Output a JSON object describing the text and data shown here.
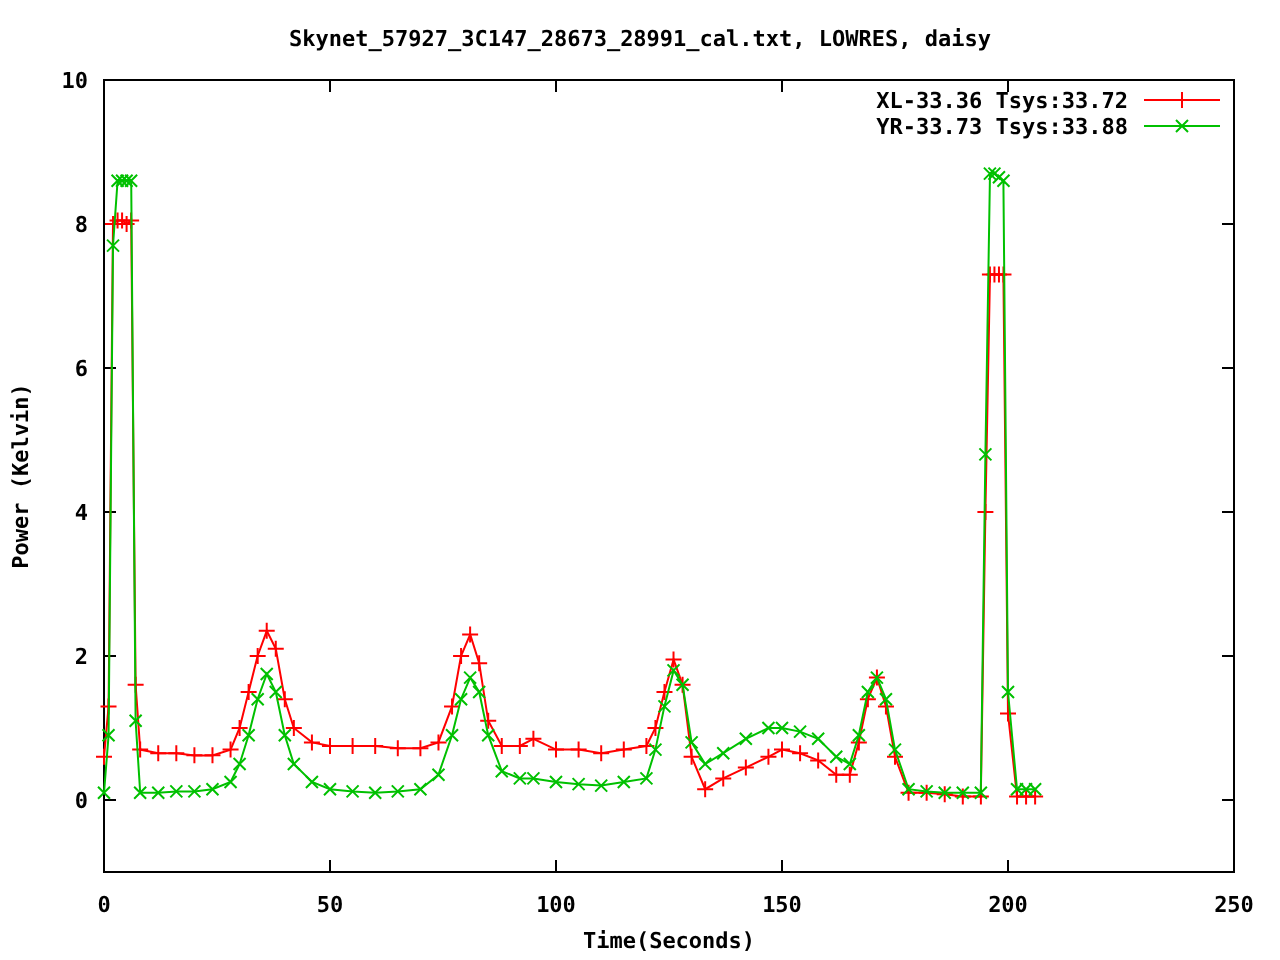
{
  "chart_data": {
    "type": "line",
    "title": "Skynet_57927_3C147_28673_28991_cal.txt, LOWRES, daisy",
    "xlabel": "Time(Seconds)",
    "ylabel": "Power (Kelvin)",
    "x": [
      0,
      1,
      2,
      3,
      4,
      5,
      6,
      7,
      8,
      12,
      16,
      20,
      24,
      28,
      30,
      32,
      34,
      36,
      38,
      40,
      42,
      46,
      50,
      55,
      60,
      65,
      70,
      74,
      77,
      79,
      81,
      83,
      85,
      88,
      92,
      95,
      100,
      105,
      110,
      115,
      120,
      122,
      124,
      126,
      128,
      130,
      133,
      137,
      142,
      147,
      150,
      154,
      158,
      162,
      165,
      167,
      169,
      171,
      173,
      175,
      178,
      182,
      186,
      190,
      194,
      195,
      196,
      197,
      198,
      199,
      200,
      202,
      204,
      206
    ],
    "series": [
      {
        "name": "XL-33.36 Tsys:33.72",
        "color": "#ff0000",
        "marker": "plus",
        "values": [
          0.6,
          1.3,
          8.0,
          8.05,
          8.05,
          8.0,
          8.05,
          1.6,
          0.7,
          0.65,
          0.65,
          0.62,
          0.62,
          0.7,
          1.0,
          1.5,
          2.0,
          2.35,
          2.1,
          1.4,
          1.0,
          0.8,
          0.75,
          0.75,
          0.75,
          0.72,
          0.72,
          0.8,
          1.3,
          2.0,
          2.3,
          1.9,
          1.1,
          0.75,
          0.75,
          0.85,
          0.7,
          0.7,
          0.65,
          0.7,
          0.75,
          1.0,
          1.5,
          1.95,
          1.6,
          0.6,
          0.15,
          0.3,
          0.45,
          0.6,
          0.7,
          0.65,
          0.55,
          0.35,
          0.35,
          0.8,
          1.4,
          1.7,
          1.3,
          0.6,
          0.1,
          0.1,
          0.08,
          0.05,
          0.05,
          4.0,
          7.3,
          7.3,
          7.3,
          7.3,
          1.2,
          0.05,
          0.05,
          0.05
        ]
      },
      {
        "name": "YR-33.73 Tsys:33.88",
        "color": "#00c000",
        "marker": "cross",
        "values": [
          0.1,
          0.9,
          7.7,
          8.6,
          8.6,
          8.6,
          8.6,
          1.1,
          0.1,
          0.1,
          0.12,
          0.12,
          0.15,
          0.25,
          0.5,
          0.9,
          1.4,
          1.75,
          1.5,
          0.9,
          0.5,
          0.25,
          0.15,
          0.12,
          0.1,
          0.12,
          0.15,
          0.35,
          0.9,
          1.4,
          1.7,
          1.5,
          0.9,
          0.4,
          0.3,
          0.3,
          0.25,
          0.22,
          0.2,
          0.25,
          0.3,
          0.7,
          1.3,
          1.8,
          1.6,
          0.8,
          0.5,
          0.65,
          0.85,
          1.0,
          1.0,
          0.95,
          0.85,
          0.6,
          0.5,
          0.9,
          1.5,
          1.7,
          1.4,
          0.7,
          0.15,
          0.12,
          0.1,
          0.1,
          0.1,
          4.8,
          8.7,
          8.7,
          8.65,
          8.6,
          1.5,
          0.15,
          0.15,
          0.15
        ]
      }
    ],
    "legend": true,
    "xlim": [
      0,
      250
    ],
    "ylim": [
      -1,
      10
    ],
    "xticks": [
      0,
      50,
      100,
      150,
      200,
      250
    ],
    "yticks": [
      0,
      2,
      4,
      6,
      8,
      10
    ]
  }
}
